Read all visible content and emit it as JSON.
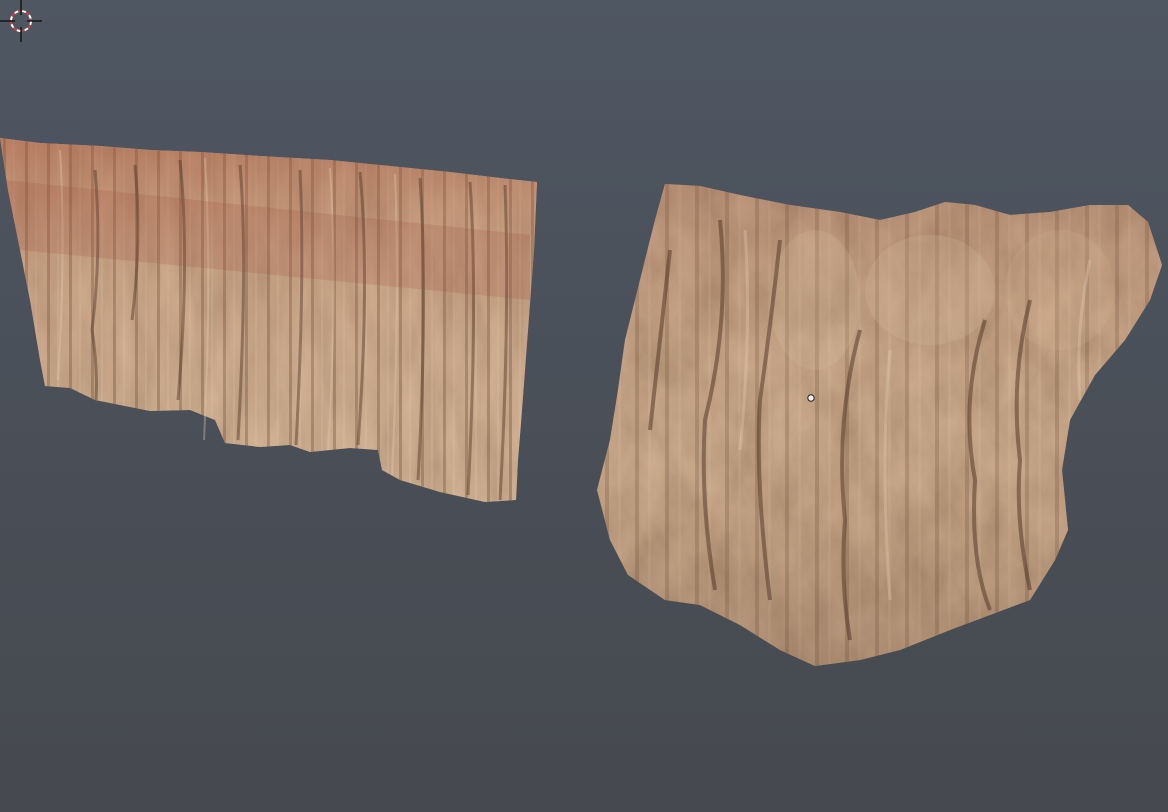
{
  "viewport": {
    "background_top": "#4f5763",
    "background_bottom": "#46494f",
    "objects": [
      {
        "name": "rock-cliff-left",
        "kind": "mesh",
        "texture": "sandstone"
      },
      {
        "name": "rock-cliff-right",
        "kind": "mesh",
        "texture": "sandstone"
      }
    ],
    "cursor": {
      "icon": "3d-cursor-icon",
      "color_ring": "#d23a3a",
      "color_ring_alt": "#ffffff"
    },
    "origin_marker": {
      "icon": "object-origin-icon"
    }
  },
  "colors": {
    "rock_light": "#c9a888",
    "rock_mid": "#a9825f",
    "rock_dark": "#6e4f38",
    "rock_red": "#a4543c"
  }
}
